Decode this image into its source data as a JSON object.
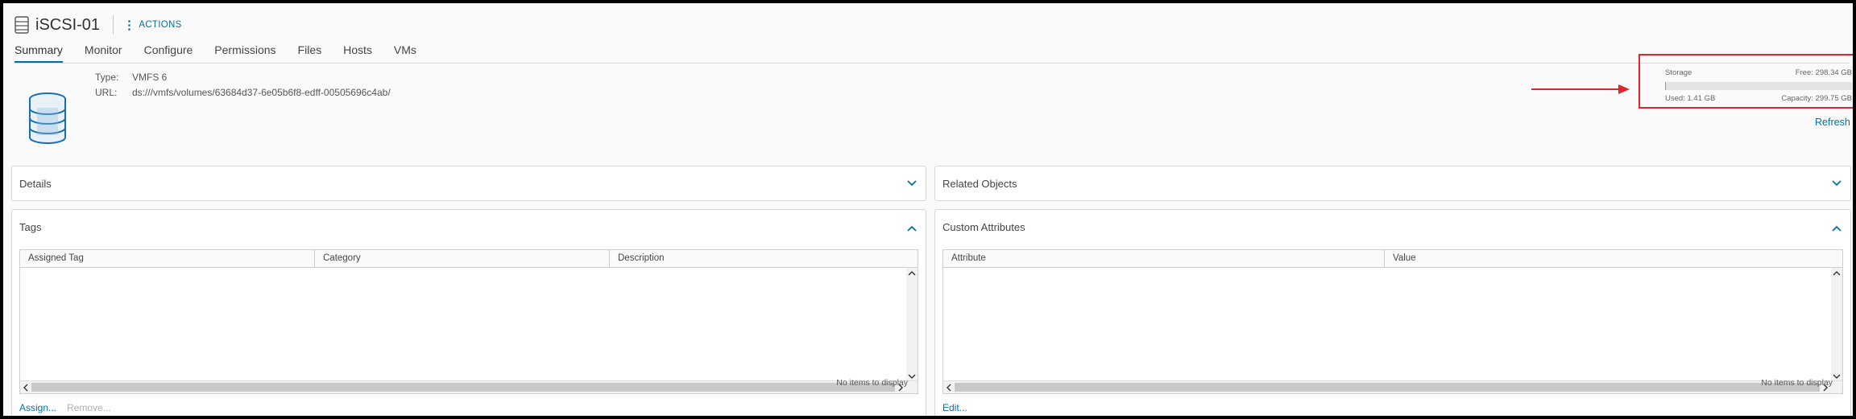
{
  "header": {
    "title": "iSCSI-01",
    "actions_label": "ACTIONS"
  },
  "tabs": [
    {
      "label": "Summary",
      "active": true
    },
    {
      "label": "Monitor"
    },
    {
      "label": "Configure"
    },
    {
      "label": "Permissions"
    },
    {
      "label": "Files"
    },
    {
      "label": "Hosts"
    },
    {
      "label": "VMs"
    }
  ],
  "summary": {
    "type_label": "Type:",
    "type_value": "VMFS 6",
    "url_label": "URL:",
    "url_value": "ds:///vmfs/volumes/63684d37-6e05b6f8-edff-00505696c4ab/"
  },
  "storage": {
    "title": "Storage",
    "free": "Free: 298.34 GB",
    "used": "Used: 1.41 GB",
    "capacity": "Capacity: 299.75 GB",
    "used_fraction": 0.0047,
    "refresh_label": "Refresh"
  },
  "panels": {
    "details": {
      "title": "Details"
    },
    "related": {
      "title": "Related Objects"
    },
    "tags": {
      "title": "Tags",
      "columns": [
        "Assigned Tag",
        "Category",
        "Description"
      ],
      "empty_text": "No items to display",
      "assign_label": "Assign...",
      "remove_label": "Remove..."
    },
    "custom_attributes": {
      "title": "Custom Attributes",
      "columns": [
        "Attribute",
        "Value"
      ],
      "empty_text": "No items to display",
      "edit_label": "Edit..."
    }
  },
  "colors": {
    "accent": "#0072a3",
    "annotation": "#e0262b"
  }
}
